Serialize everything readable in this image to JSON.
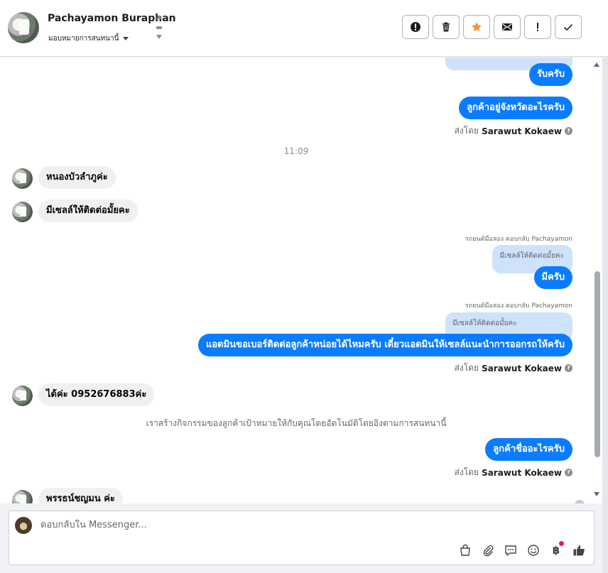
{
  "header": {
    "contact_name": "Pachayamon Buraphan",
    "assign_label": "มอบหมายการสนทนานี้",
    "actions": [
      {
        "name": "spam",
        "icon": "alert-circle-icon"
      },
      {
        "name": "delete",
        "icon": "trash-icon"
      },
      {
        "name": "star",
        "icon": "star-icon",
        "color": "#f7923b"
      },
      {
        "name": "mark-unread",
        "icon": "envelope-icon"
      },
      {
        "name": "follow-up",
        "icon": "exclamation-icon"
      },
      {
        "name": "done",
        "icon": "check-icon"
      }
    ]
  },
  "messages": {
    "m1": "รับครับ",
    "m2": "ลูกค้าอยู่จังหวัดอะไรครับ",
    "sent_by_prefix": "ส่งโดย",
    "agent": "Sarawut Kokaew",
    "time1": "11:09",
    "in1": "หนองบัวลำภูค่ะ",
    "in2": "มีเซลล์ให้ติดต่อมั้ยคะ",
    "reply_meta": "รถยนต์มือสอง ตอบกลับ Pachayamon",
    "quoted": "มีเซลล์ให้ติดต่อมั้ยคะ",
    "m3": "มีครับ",
    "m4": "แอดมินขอเบอร์ติดต่อลูกค้าหน่อยได้ไหมครับ เดี๋ยวแอดมินให้เซลล์แนะนำการออกรถให้ครับ",
    "in3": "ได้ค่ะ 0952676883ค่ะ",
    "system_note": "เราสร้างกิจกรรมของลูกค้าเป้าหมายให้กับคุณโดยอัตโนมัติโดยอิงตามการสนทนานี้",
    "m5": "ลูกค้าชื่ออะไรครับ",
    "in4": "พรรธน์ชญมน ค่ะ"
  },
  "composer": {
    "placeholder": "ตอบกลับใน Messenger...",
    "baht": "฿"
  },
  "colors": {
    "outgoing_bubble": "#0a7cff",
    "incoming_bubble": "#f0f0f0",
    "quoted_bubble": "#cfe2fb",
    "star": "#f7923b",
    "notification_dot": "#e41e3f"
  }
}
